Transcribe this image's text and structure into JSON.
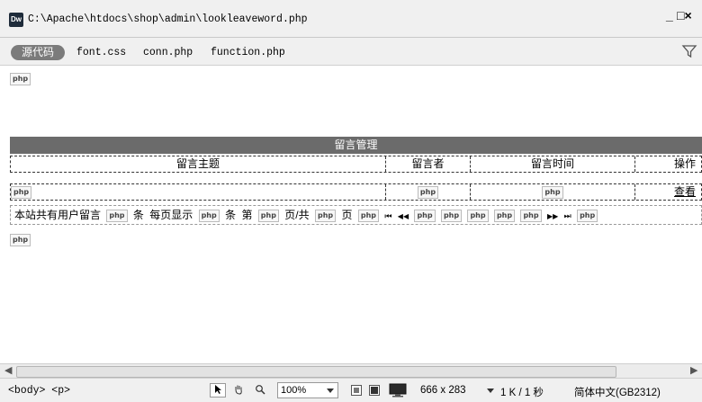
{
  "window": {
    "logo": "Dw",
    "title": "C:\\Apache\\htdocs\\shop\\admin\\lookleaveword.php",
    "minimize": "_",
    "close": "□×"
  },
  "related_files": {
    "source_button": "源代码",
    "files": [
      "font.css",
      "conn.php",
      "function.php"
    ]
  },
  "design": {
    "php_badge": "php",
    "table_title": "留言管理",
    "columns": [
      "留言主题",
      "留言者",
      "留言时间",
      "操作"
    ],
    "row_action": "查看",
    "nav": {
      "total_label": "本站共有用户留言",
      "unit1": "条",
      "per_page_label": "每页显示",
      "unit2": "条",
      "page_prefix": "第",
      "page_mid": "页/共",
      "page_suffix": "页",
      "first": "⏮",
      "prev": "◀◀",
      "next": "▶▶",
      "last": "⏭"
    }
  },
  "status": {
    "tag_selector": "<body> <p>",
    "zoom": "100%",
    "window_size": "666 x 283",
    "download": "1 K / 1 秒",
    "encoding": "简体中文(GB2312)"
  }
}
